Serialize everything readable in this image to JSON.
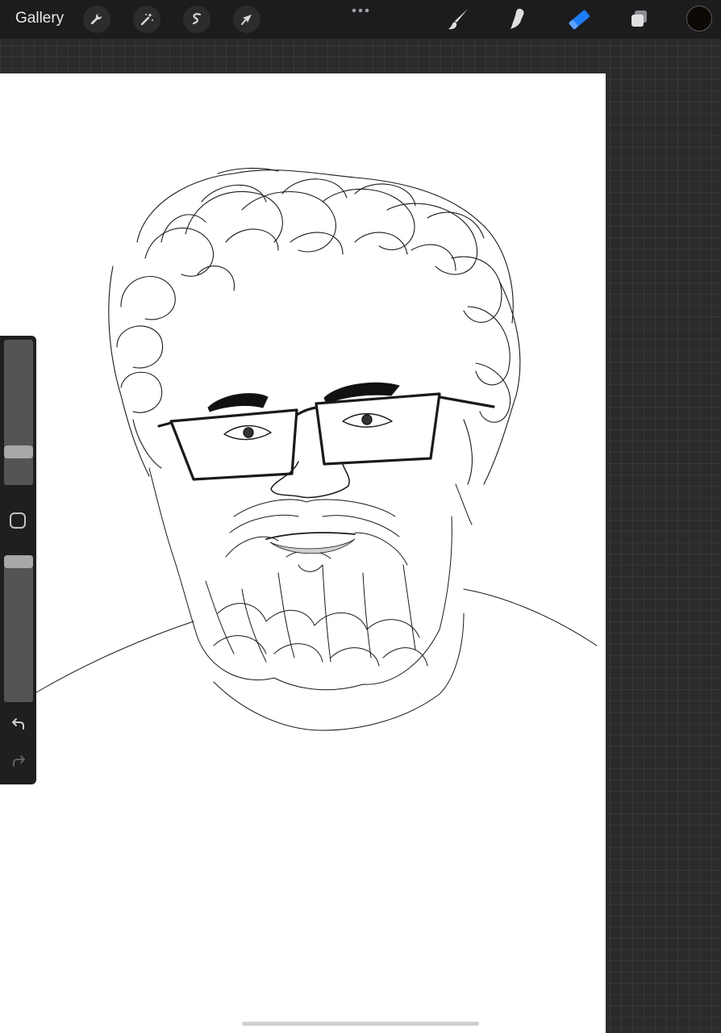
{
  "toolbar": {
    "gallery_label": "Gallery",
    "left_tools": [
      "wrench-icon",
      "magic-wand-icon",
      "selection-icon",
      "transform-arrow-icon"
    ],
    "right_tools": [
      "brush-icon",
      "smudge-icon",
      "eraser-icon",
      "layers-icon"
    ],
    "active_tool": "eraser",
    "active_color": "#0f0905",
    "accent_color": "#1e7cf5"
  },
  "sidebar": {
    "brush_size_level": 0.2,
    "brush_opacity_level": 1.0,
    "buttons": [
      "modify-button",
      "undo-button",
      "redo-button"
    ]
  }
}
